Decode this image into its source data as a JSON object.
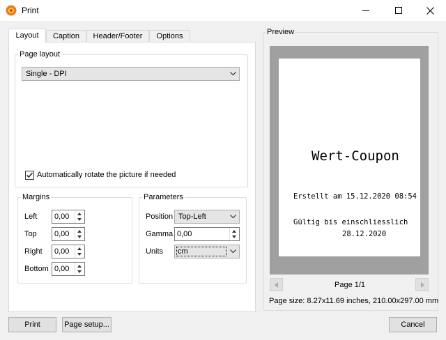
{
  "window": {
    "title": "Print"
  },
  "tabs": [
    {
      "label": "Layout",
      "active": true
    },
    {
      "label": "Caption"
    },
    {
      "label": "Header/Footer"
    },
    {
      "label": "Options"
    }
  ],
  "layout": {
    "group_label": "Page layout",
    "page_layout_value": "Single - DPI",
    "auto_rotate_label": "Automatically rotate the picture if needed",
    "auto_rotate_checked": true
  },
  "margins": {
    "group_label": "Margins",
    "fields": [
      {
        "label": "Left",
        "value": "0,00"
      },
      {
        "label": "Top",
        "value": "0,00"
      },
      {
        "label": "Right",
        "value": "0,00"
      },
      {
        "label": "Bottom",
        "value": "0,00"
      }
    ]
  },
  "parameters": {
    "group_label": "Parameters",
    "position_label": "Position",
    "position_value": "Top-Left",
    "gamma_label": "Gamma",
    "gamma_value": "0,00",
    "units_label": "Units",
    "units_value": "cm"
  },
  "preview": {
    "label": "Preview",
    "coupon_title": "Wert-Coupon",
    "coupon_created": "Erstellt am 15.12.2020 08:54",
    "coupon_valid": "Gültig bis einschliesslich",
    "coupon_date": "28.12.2020",
    "page_indicator": "Page 1/1",
    "page_size": "Page size: 8.27x11.69 inches, 210.00x297.00 mm"
  },
  "buttons": {
    "print": "Print",
    "page_setup": "Page setup...",
    "cancel": "Cancel"
  },
  "colors": {
    "dialog_bg": "#f0f0f0",
    "preview_bg": "#a0a0a0",
    "check_accent": "#333333"
  },
  "icons": [
    "app-sun-icon",
    "minimize-icon",
    "maximize-icon",
    "close-icon",
    "chevron-down-icon",
    "checkmark-icon",
    "spin-up-icon",
    "spin-down-icon",
    "arrow-left-icon",
    "arrow-right-icon"
  ]
}
